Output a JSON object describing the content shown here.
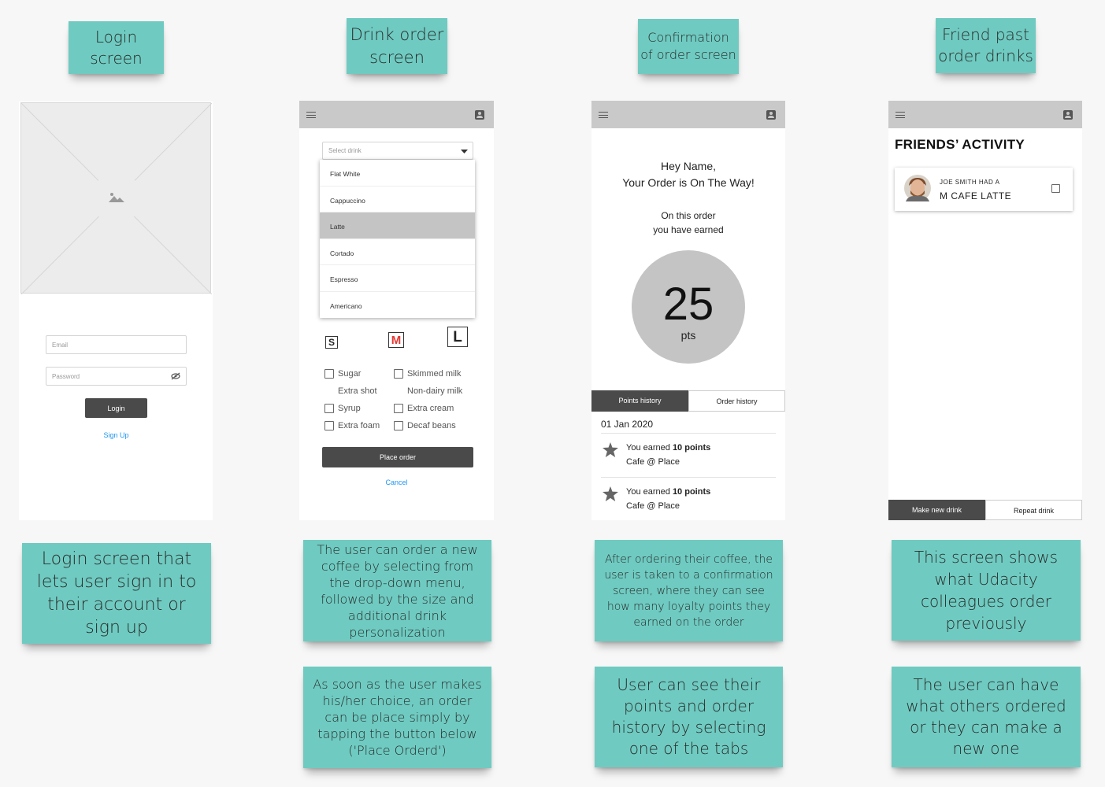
{
  "headings": {
    "login": "Login\nscreen",
    "drink_order": "Drink order\nscreen",
    "confirmation": "Confirmation\nof order screen",
    "friends": "Friend past\norder drinks"
  },
  "notes": {
    "login": "Login screen that lets user sign in to their account or sign up",
    "drink_1": "The user can order a new coffee by selecting from the drop-down menu, followed by the size and additional drink personalization",
    "drink_2": "As soon as the user makes his/her choice, an order can be place simply by tapping the button below ('Place Orderd')",
    "confirm_1": "After ordering their coffee, the user is taken to a confirmation screen, where they can see how many loyalty points they earned on the order",
    "confirm_2": "User can see their points and order history by selecting one of the tabs",
    "friends_1": "This screen shows what Udacity colleagues order previously",
    "friends_2": "The user can have what others ordered or they can make a new one"
  },
  "login": {
    "email_placeholder": "Email",
    "password_placeholder": "Password",
    "login_label": "Login",
    "signup_label": "Sign Up"
  },
  "drink_order": {
    "select_placeholder": "Select drink",
    "drinks": [
      "Flat White",
      "Cappuccino",
      "Latte",
      "Cortado",
      "Espresso",
      "Americano"
    ],
    "selected_drink": "Latte",
    "sizes": [
      "S",
      "M",
      "L"
    ],
    "options_left": [
      "Sugar",
      "Extra shot",
      "Syrup",
      "Extra foam"
    ],
    "options_right": [
      "Skimmed milk",
      "Non-dairy milk",
      "Extra cream",
      "Decaf beans"
    ],
    "place_order": "Place order",
    "cancel": "Cancel"
  },
  "confirmation": {
    "greeting_line1": "Hey Name,",
    "greeting_line2": "Your Order is On The Way!",
    "earned_line1": "On this order",
    "earned_line2": "you have earned",
    "points": "25",
    "points_unit": "pts",
    "tab_points": "Points history",
    "tab_orders": "Order history",
    "date": "01 Jan 2020",
    "history": [
      {
        "prefix": "You earned ",
        "points": "10 points",
        "place": "Cafe @ Place"
      },
      {
        "prefix": "You earned ",
        "points": "10 points",
        "place": "Cafe @ Place"
      }
    ]
  },
  "friends": {
    "title": "FRIENDS’ ACTIVITY",
    "card_line1": "JOE SMITH HAD A",
    "card_line2": "M CAFE LATTE",
    "make_new": "Make new drink",
    "repeat": "Repeat drink"
  },
  "colors": {
    "sticky": "#6fcbc1",
    "appbar": "#c9c9c9",
    "dark_button": "#4a4a4a",
    "link": "#2196f3",
    "size_m": "#e53935"
  }
}
